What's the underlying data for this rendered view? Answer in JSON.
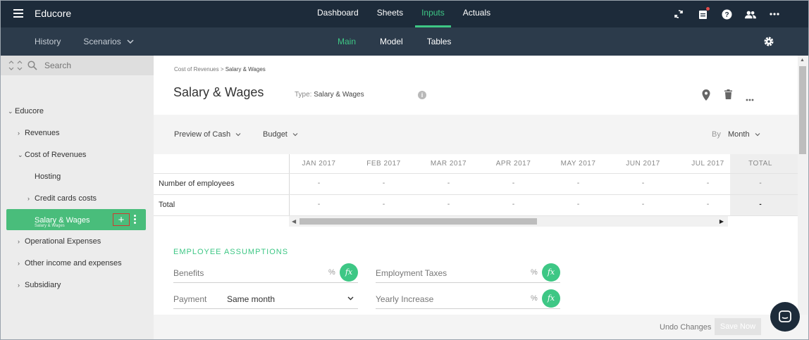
{
  "app": {
    "brand": "Educore"
  },
  "topnav": [
    {
      "label": "Dashboard"
    },
    {
      "label": "Sheets"
    },
    {
      "label": "Inputs"
    },
    {
      "label": "Actuals"
    }
  ],
  "subbar": {
    "history": "History",
    "scenarios": "Scenarios",
    "tabs": [
      {
        "label": "Main"
      },
      {
        "label": "Model"
      },
      {
        "label": "Tables"
      }
    ]
  },
  "sidebar": {
    "search_placeholder": "Search",
    "items": [
      {
        "label": "Educore"
      },
      {
        "label": "Revenues"
      },
      {
        "label": "Cost of Revenues"
      },
      {
        "label": "Hosting"
      },
      {
        "label": "Credit cards costs"
      },
      {
        "label": "Salary & Wages",
        "sublabel": "Salary & Wages"
      },
      {
        "label": "Operational Expenses"
      },
      {
        "label": "Other income and expenses"
      },
      {
        "label": "Subsidiary"
      }
    ],
    "plus_glyph": "+"
  },
  "page": {
    "breadcrumb_parent": "Cost of Revenues",
    "breadcrumb_sep": " > ",
    "breadcrumb_current": "Salary & Wages",
    "title": "Salary & Wages",
    "type_label": "Type:",
    "type_value": "Salary & Wages",
    "info_glyph": "i"
  },
  "controls": {
    "preview": "Preview of Cash",
    "budget": "Budget",
    "by_label": "By",
    "by_value": "Month"
  },
  "table": {
    "columns": [
      "JAN 2017",
      "FEB 2017",
      "MAR 2017",
      "APR 2017",
      "MAY 2017",
      "JUN 2017",
      "JUL 2017",
      "TOTAL"
    ],
    "rows": [
      {
        "label": "Number of employees",
        "cells": [
          "-",
          "-",
          "-",
          "-",
          "-",
          "-",
          "-",
          "-"
        ]
      },
      {
        "label": "Total",
        "cells": [
          "-",
          "-",
          "-",
          "-",
          "-",
          "-",
          "-",
          "-"
        ]
      }
    ]
  },
  "assumptions": {
    "title": "EMPLOYEE ASSUMPTIONS",
    "benefits": {
      "label": "Benefits",
      "unit": "%"
    },
    "employment_taxes": {
      "label": "Employment Taxes",
      "unit": "%"
    },
    "payment": {
      "label": "Payment",
      "value": "Same month"
    },
    "yearly_increase": {
      "label": "Yearly Increase",
      "unit": "%"
    },
    "fx_glyph": "fx"
  },
  "footer": {
    "undo": "Undo Changes",
    "save": "Save Now"
  },
  "colors": {
    "topbar": "#1d2b3a",
    "subbar": "#2c3b4b",
    "accent": "#3ec785",
    "selected": "#49bd7b",
    "highlight_box": "#d0392f"
  }
}
